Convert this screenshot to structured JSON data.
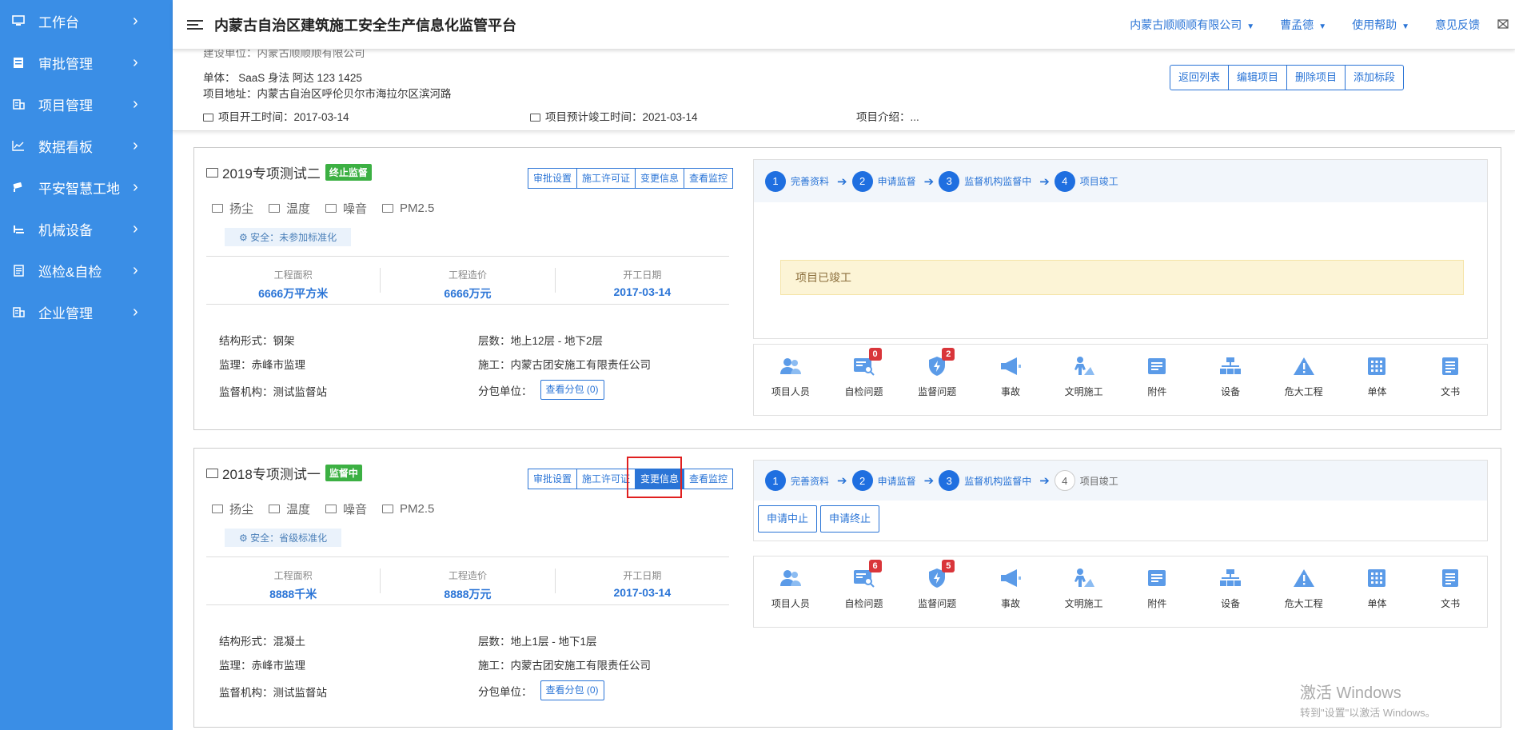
{
  "sidebar": {
    "items": [
      {
        "label": "工作台",
        "icon": "monitor-icon"
      },
      {
        "label": "审批管理",
        "icon": "document-icon"
      },
      {
        "label": "项目管理",
        "icon": "building-icon"
      },
      {
        "label": "数据看板",
        "icon": "line-chart-icon"
      },
      {
        "label": "平安智慧工地",
        "icon": "camera-icon"
      },
      {
        "label": "机械设备",
        "icon": "machine-icon"
      },
      {
        "label": "巡检&自检",
        "icon": "checklist-icon"
      },
      {
        "label": "企业管理",
        "icon": "building-icon"
      }
    ]
  },
  "header": {
    "title": "内蒙古自治区建筑施工安全生产信息化监管平台",
    "company": "内蒙古顺顺顺有限公司",
    "user": "曹孟德",
    "help": "使用帮助",
    "feedback": "意见反馈"
  },
  "project_info": {
    "builder_partial": "建设单位：内蒙古顺顺顺有限公司",
    "units": "单体：  SaaS  身法  阿达  123  1425",
    "address": "项目地址：内蒙古自治区呼伦贝尔市海拉尔区滨河路",
    "start_time": "项目开工时间：2017-03-14",
    "expected_end": "项目预计竣工时间：2021-03-14",
    "intro": "项目介绍：...",
    "buttons": [
      "返回列表",
      "编辑项目",
      "删除项目",
      "添加标段"
    ]
  },
  "sections": [
    {
      "name": "2019专项测试二",
      "status": "终止监督",
      "actions": [
        "审批设置",
        "施工许可证",
        "变更信息",
        "查看监控"
      ],
      "sensors": [
        "扬尘",
        "温度",
        "噪音",
        "PM2.5"
      ],
      "safety": "安全：未参加标准化",
      "stats": [
        {
          "label": "工程面积",
          "value": "6666万平方米"
        },
        {
          "label": "工程造价",
          "value": "6666万元"
        },
        {
          "label": "开工日期",
          "value": "2017-03-14"
        }
      ],
      "structure": "结构形式：钢架",
      "floors": "层数：地上12层 - 地下2层",
      "supervisor": "监理：赤峰市监理",
      "contractor": "施工：内蒙古团安施工有限责任公司",
      "agency": "监督机构：测试监督站",
      "subcontract_label": "分包单位：",
      "subcontract_btn": "查看分包 (0)",
      "steps": [
        {
          "n": "1",
          "label": "完善资料",
          "done": true
        },
        {
          "n": "2",
          "label": "申请监督",
          "done": true
        },
        {
          "n": "3",
          "label": "监督机构监督中",
          "done": true
        },
        {
          "n": "4",
          "label": "项目竣工",
          "done": true
        }
      ],
      "notice": "项目已竣工",
      "icons": [
        {
          "label": "项目人员",
          "count": ""
        },
        {
          "label": "自检问题",
          "count": "0"
        },
        {
          "label": "监督问题",
          "count": "2"
        },
        {
          "label": "事故",
          "count": ""
        },
        {
          "label": "文明施工",
          "count": ""
        },
        {
          "label": "附件",
          "count": ""
        },
        {
          "label": "设备",
          "count": ""
        },
        {
          "label": "危大工程",
          "count": ""
        },
        {
          "label": "单体",
          "count": ""
        },
        {
          "label": "文书",
          "count": ""
        }
      ]
    },
    {
      "name": "2018专项测试一",
      "status": "监督中",
      "actions": [
        "审批设置",
        "施工许可证",
        "变更信息",
        "查看监控"
      ],
      "sensors": [
        "扬尘",
        "温度",
        "噪音",
        "PM2.5"
      ],
      "safety": "安全：省级标准化",
      "stats": [
        {
          "label": "工程面积",
          "value": "8888千米"
        },
        {
          "label": "工程造价",
          "value": "8888万元"
        },
        {
          "label": "开工日期",
          "value": "2017-03-14"
        }
      ],
      "structure": "结构形式：混凝土",
      "floors": "层数：地上1层 - 地下1层",
      "supervisor": "监理：赤峰市监理",
      "contractor": "施工：内蒙古团安施工有限责任公司",
      "agency": "监督机构：测试监督站",
      "subcontract_label": "分包单位：",
      "subcontract_btn": "查看分包 (0)",
      "steps": [
        {
          "n": "1",
          "label": "完善资料",
          "done": true
        },
        {
          "n": "2",
          "label": "申请监督",
          "done": true
        },
        {
          "n": "3",
          "label": "监督机构监督中",
          "done": true
        },
        {
          "n": "4",
          "label": "项目竣工",
          "done": false
        }
      ],
      "buttons": [
        "申请中止",
        "申请终止"
      ],
      "icons": [
        {
          "label": "项目人员",
          "count": ""
        },
        {
          "label": "自检问题",
          "count": "6"
        },
        {
          "label": "监督问题",
          "count": "5"
        },
        {
          "label": "事故",
          "count": ""
        },
        {
          "label": "文明施工",
          "count": ""
        },
        {
          "label": "附件",
          "count": ""
        },
        {
          "label": "设备",
          "count": ""
        },
        {
          "label": "危大工程",
          "count": ""
        },
        {
          "label": "单体",
          "count": ""
        },
        {
          "label": "文书",
          "count": ""
        }
      ]
    }
  ],
  "watermark": {
    "line1": "激活 Windows",
    "line2": "转到\"设置\"以激活 Windows。"
  },
  "colors": {
    "sidebar": "#3a8ee6",
    "primary": "#2a74d6",
    "status_green": "#3cb043",
    "count_red": "#d9353a",
    "highlight": "#e02020"
  }
}
